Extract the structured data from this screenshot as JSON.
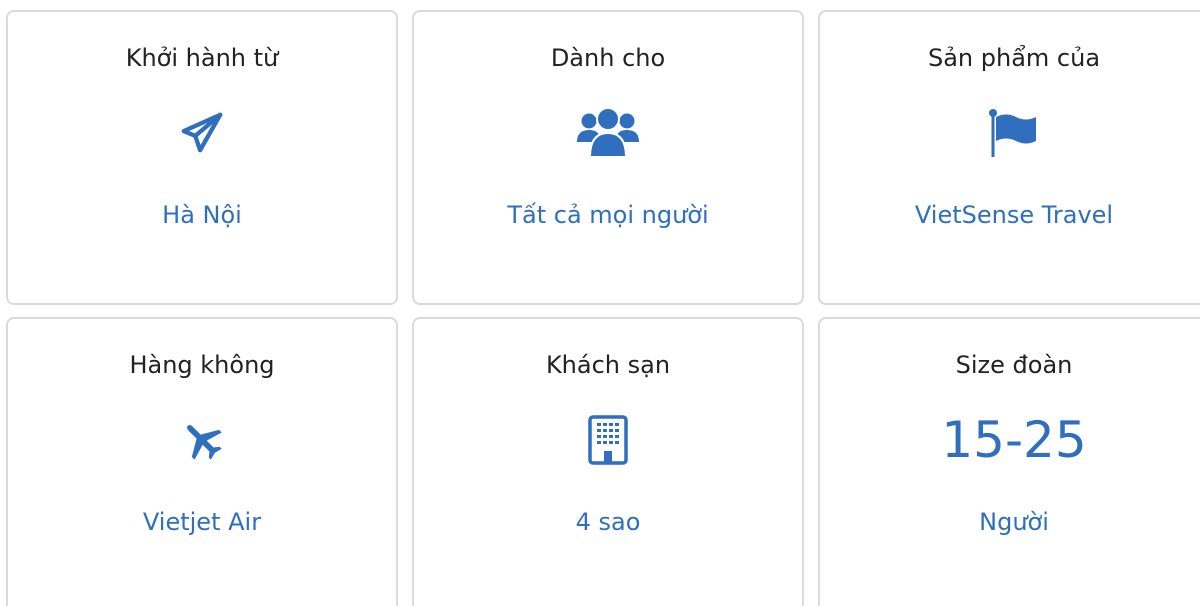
{
  "cards": [
    {
      "title": "Khởi hành từ",
      "icon": "paper-plane-icon",
      "value": "Hà Nội"
    },
    {
      "title": "Dành cho",
      "icon": "users-group-icon",
      "value": "Tất cả mọi người"
    },
    {
      "title": "Sản phẩm của",
      "icon": "flag-icon",
      "value": "VietSense Travel"
    },
    {
      "title": "Hàng không",
      "icon": "airplane-icon",
      "value": "Vietjet Air"
    },
    {
      "title": "Khách sạn",
      "icon": "building-icon",
      "value": "4 sao"
    },
    {
      "title": "Size đoàn",
      "big_value": "15-25",
      "value": "Người"
    }
  ],
  "colors": {
    "accent": "#2f6fbd",
    "border": "#dadada",
    "text": "#222222"
  }
}
